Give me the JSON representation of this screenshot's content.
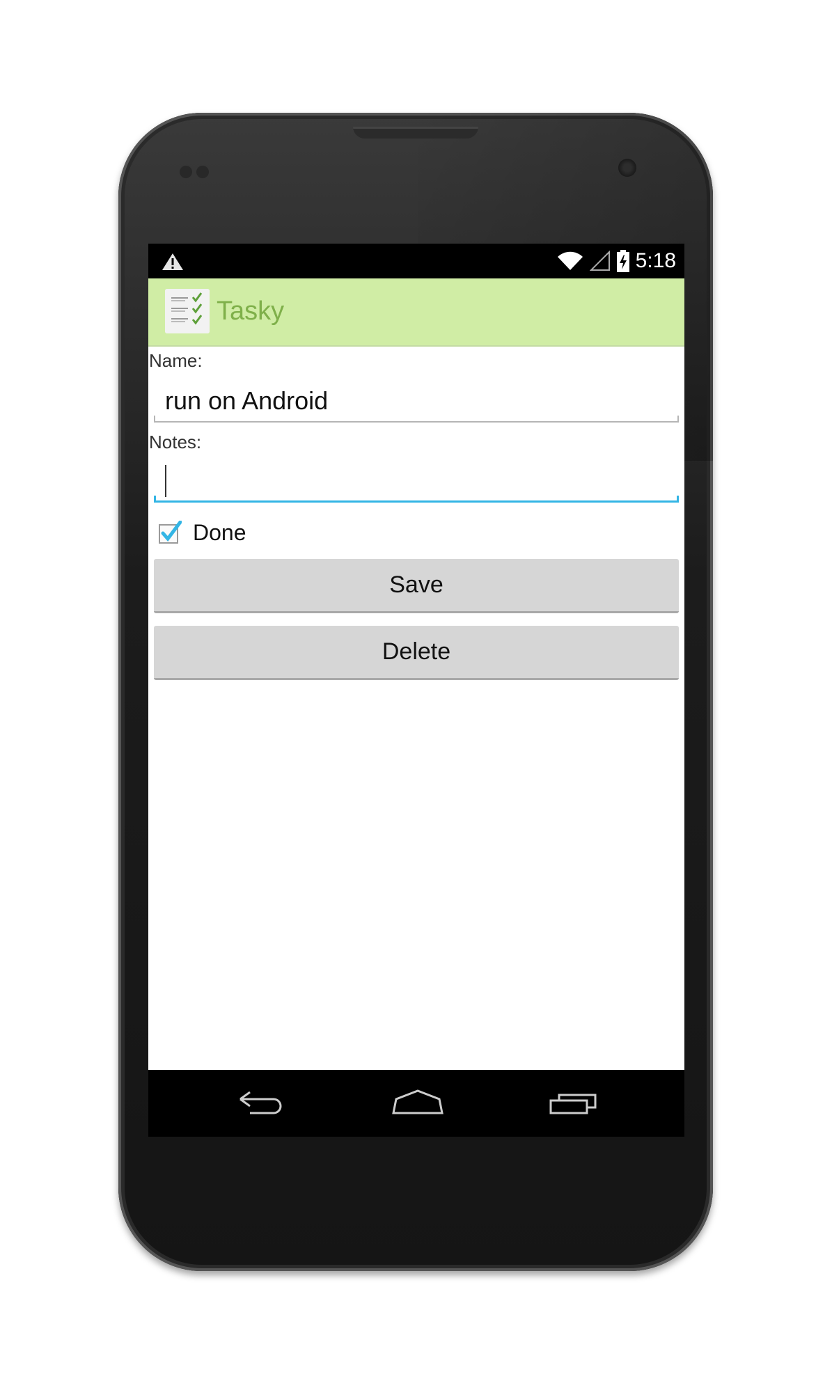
{
  "status_bar": {
    "warning_icon": "warning-icon",
    "wifi_icon": "wifi-icon",
    "signal_icon": "signal-icon",
    "battery_icon": "battery-charging-icon",
    "time": "5:18"
  },
  "action_bar": {
    "app_icon": "tasky-checklist-icon",
    "title": "Tasky",
    "background_color": "#d0eda5",
    "title_color": "#7fb04a"
  },
  "form": {
    "name_label": "Name:",
    "name_value": "run on Android",
    "notes_label": "Notes:",
    "notes_value": "",
    "done_label": "Done",
    "done_checked": true,
    "focus_color": "#33b5e5"
  },
  "buttons": {
    "save_label": "Save",
    "delete_label": "Delete"
  },
  "nav_bar": {
    "back_icon": "back-icon",
    "home_icon": "home-icon",
    "recents_icon": "recent-apps-icon"
  }
}
